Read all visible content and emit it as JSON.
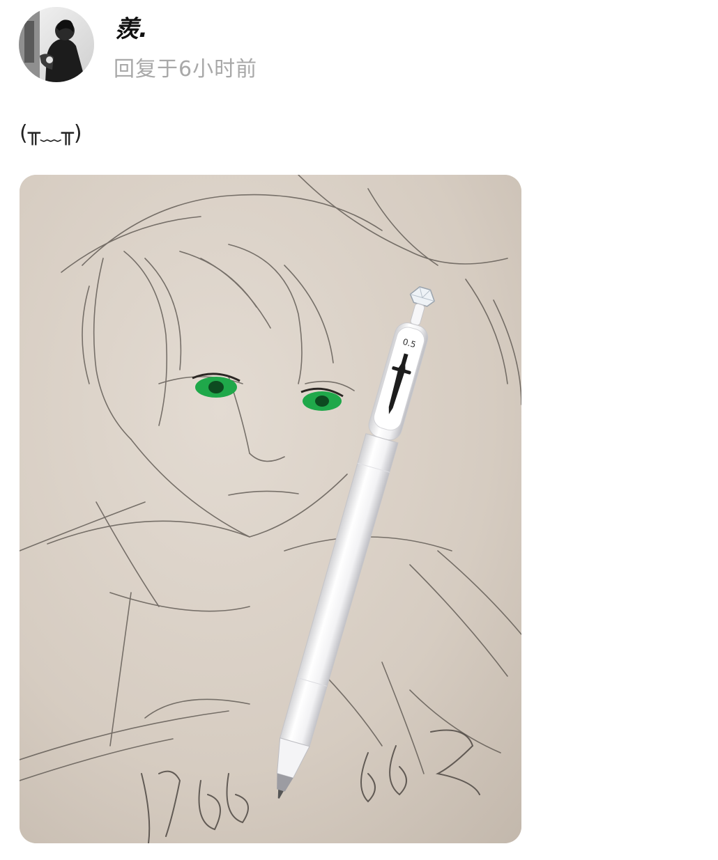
{
  "post": {
    "author": {
      "name": "羨.",
      "avatar_icon": "user-avatar-icon"
    },
    "timestamp": "回复于6小时前",
    "text": "(╥﹏╥)"
  },
  "photo": {
    "subject": "pencil-sketch-with-pen",
    "pen_size_label": "0.5"
  },
  "colors": {
    "background": "#ffffff",
    "timestamp": "#a8a8a8",
    "paper": "#d9d0c6",
    "eye_green": "#1fa84a"
  }
}
